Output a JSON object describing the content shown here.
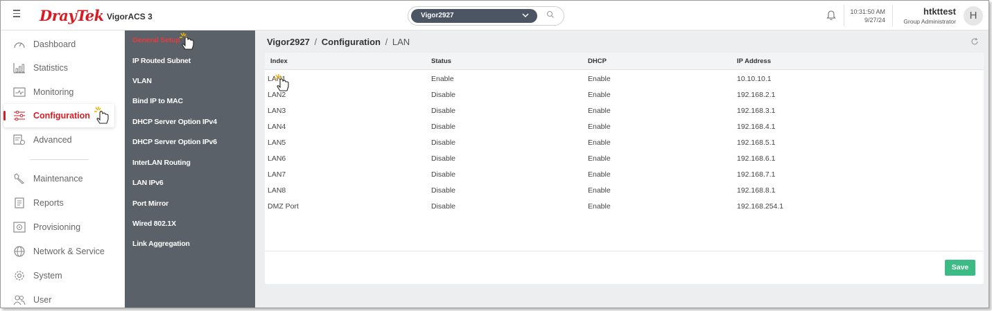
{
  "header": {
    "brand": "DrayTek",
    "product": "VigorACS 3",
    "device_selector": {
      "value": "Vigor2927"
    },
    "time": "10:31:50 AM",
    "date": "9/27/24",
    "user": {
      "name": "htkttest",
      "role": "Group Administrator",
      "initial": "H"
    }
  },
  "leftnav": {
    "items": [
      {
        "label": "Dashboard",
        "icon": "dashboard-icon"
      },
      {
        "label": "Statistics",
        "icon": "statistics-icon"
      },
      {
        "label": "Monitoring",
        "icon": "monitoring-icon"
      },
      {
        "label": "Configuration",
        "icon": "configuration-icon",
        "active": true
      },
      {
        "label": "Advanced",
        "icon": "advanced-icon"
      },
      {
        "label": "Maintenance",
        "icon": "maintenance-icon"
      },
      {
        "label": "Reports",
        "icon": "reports-icon"
      },
      {
        "label": "Provisioning",
        "icon": "provisioning-icon"
      },
      {
        "label": "Network & Service",
        "icon": "globe-icon"
      },
      {
        "label": "System",
        "icon": "gear-icon"
      },
      {
        "label": "User",
        "icon": "users-icon"
      }
    ]
  },
  "submenu": {
    "items": [
      {
        "label": "General Setup",
        "active": true
      },
      {
        "label": "IP Routed Subnet"
      },
      {
        "label": "VLAN"
      },
      {
        "label": "Bind IP to MAC"
      },
      {
        "label": "DHCP Server Option IPv4"
      },
      {
        "label": "DHCP Server Option IPv6"
      },
      {
        "label": "InterLAN Routing"
      },
      {
        "label": "LAN IPv6"
      },
      {
        "label": "Port Mirror"
      },
      {
        "label": "Wired 802.1X"
      },
      {
        "label": "Link Aggregation"
      }
    ]
  },
  "breadcrumb": {
    "device": "Vigor2927",
    "section": "Configuration",
    "page": "LAN",
    "separator": "/"
  },
  "table": {
    "columns": [
      "Index",
      "Status",
      "DHCP",
      "IP Address"
    ],
    "rows": [
      [
        "LAN1",
        "Enable",
        "Enable",
        "10.10.10.1"
      ],
      [
        "LAN2",
        "Disable",
        "Enable",
        "192.168.2.1"
      ],
      [
        "LAN3",
        "Disable",
        "Enable",
        "192.168.3.1"
      ],
      [
        "LAN4",
        "Disable",
        "Enable",
        "192.168.4.1"
      ],
      [
        "LAN5",
        "Disable",
        "Enable",
        "192.168.5.1"
      ],
      [
        "LAN6",
        "Disable",
        "Enable",
        "192.168.6.1"
      ],
      [
        "LAN7",
        "Disable",
        "Enable",
        "192.168.7.1"
      ],
      [
        "LAN8",
        "Disable",
        "Enable",
        "192.168.8.1"
      ],
      [
        "DMZ Port",
        "Disable",
        "Enable",
        "192.168.254.1"
      ]
    ]
  },
  "actions": {
    "save_label": "Save"
  },
  "colors": {
    "brand_red": "#d71c23",
    "submenu_bg": "#5b6169",
    "save_green": "#3dbb85"
  }
}
